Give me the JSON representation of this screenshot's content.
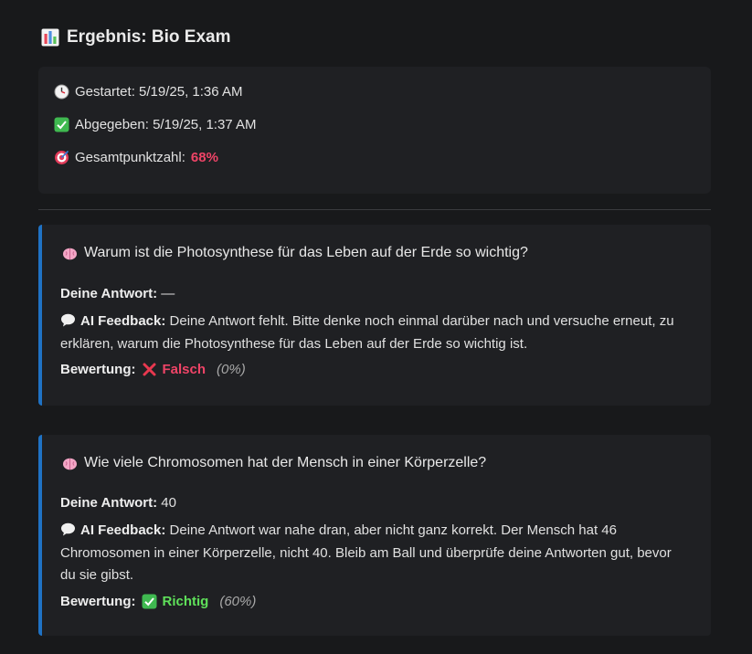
{
  "header": {
    "icon": "bar-chart-icon",
    "title": "Ergebnis: Bio Exam"
  },
  "summary": {
    "started_label": "Gestartet: 5/19/25, 1:36 AM",
    "submitted_label": "Abgegeben: 5/19/25, 1:37 AM",
    "score_label": "Gesamtpunktzahl:",
    "score_value": "68%"
  },
  "colors": {
    "accent_border": "#1f72c4",
    "wrong": "#ef4467",
    "correct": "#5fe05a",
    "score": "#ef4467"
  },
  "questions": [
    {
      "question": "Warum ist die Photosynthese für das Leben auf der Erde so wichtig?",
      "answer_label": "Deine Antwort:",
      "answer": "—",
      "feedback_label": "AI Feedback:",
      "feedback": "Deine Antwort fehlt. Bitte denke noch einmal darüber nach und versuche erneut, zu erklären, warum die Photosynthese für das Leben auf der Erde so wichtig ist.",
      "rating_label": "Bewertung:",
      "rating": "Falsch",
      "rating_icon": "cross-icon",
      "percent": "(0%)"
    },
    {
      "question": "Wie viele Chromosomen hat der Mensch in einer Körperzelle?",
      "answer_label": "Deine Antwort:",
      "answer": "40",
      "feedback_label": "AI Feedback:",
      "feedback": "Deine Antwort war nahe dran, aber nicht ganz korrekt. Der Mensch hat 46 Chromosomen in einer Körperzelle, nicht 40. Bleib am Ball und überprüfe deine Antworten gut, bevor du sie gibst.",
      "rating_label": "Bewertung:",
      "rating": "Richtig",
      "rating_icon": "check-icon",
      "percent": "(60%)"
    }
  ]
}
